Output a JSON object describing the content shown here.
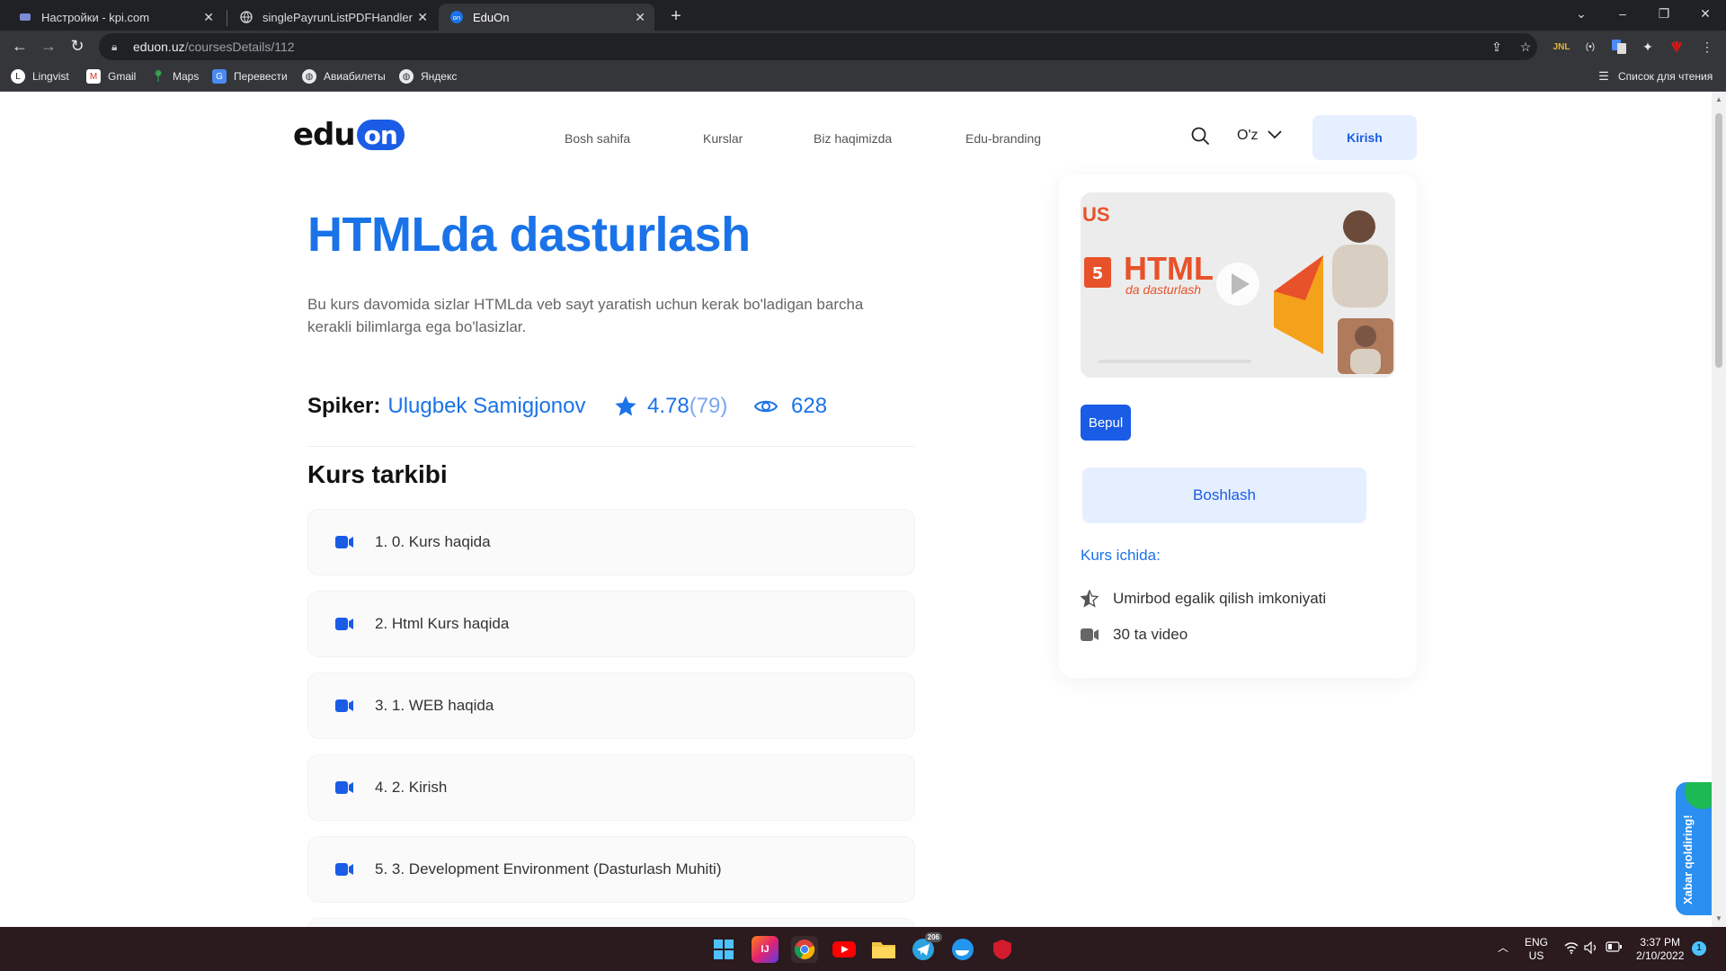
{
  "browser": {
    "tabs": [
      {
        "title": "Настройки - kpi.com",
        "active": false
      },
      {
        "title": "singlePayrunListPDFHandler",
        "active": false
      },
      {
        "title": "EduOn",
        "active": true
      }
    ],
    "url_host": "eduon.uz",
    "url_path": "/coursesDetails/112",
    "bookmarks": [
      "Lingvist",
      "Gmail",
      "Maps",
      "Перевести",
      "Авиабилеты",
      "Яндекс"
    ],
    "reading_list": "Список для чтения"
  },
  "site": {
    "logo_text": "edu",
    "logo_badge": "on",
    "nav": [
      "Bosh sahifa",
      "Kurslar",
      "Biz haqimizda",
      "Edu-branding"
    ],
    "language": "O'z",
    "login": "Kirish"
  },
  "course": {
    "title": "HTMLda dasturlash",
    "description": "Bu kurs davomida sizlar HTMLda veb sayt yaratish uchun kerak bo'ladigan barcha kerakli bilimlarga ega bo'lasizlar.",
    "speaker_label": "Spiker:",
    "speaker_name": "Ulugbek Samigjonov",
    "rating": "4.78",
    "rating_count": "(79)",
    "views": "628",
    "contents_title": "Kurs tarkibi",
    "lessons": [
      "1. 0. Kurs haqida",
      "2. Html Kurs haqida",
      "3. 1. WEB haqida",
      "4. 2. Kirish",
      "5. 3. Development Environment (Dasturlash Muhiti)"
    ]
  },
  "card": {
    "thumb_brand": "US",
    "thumb_html": "HTML",
    "thumb_sub": "da dasturlash",
    "price_badge": "Bepul",
    "start_button": "Boshlash",
    "inside_title": "Kurs ichida:",
    "features": [
      "Umirbod egalik qilish imkoniyati",
      "30 ta video"
    ]
  },
  "feedback": "Xabar qoldiring!",
  "taskbar": {
    "lang_top": "ENG",
    "lang_bottom": "US",
    "time": "3:37 PM",
    "date": "2/10/2022",
    "notif": "1",
    "telegram_badge": "206"
  },
  "colors": {
    "accent": "#1a73e8",
    "brand_blue": "#1a5ce6",
    "light_blue": "#e6efff"
  }
}
